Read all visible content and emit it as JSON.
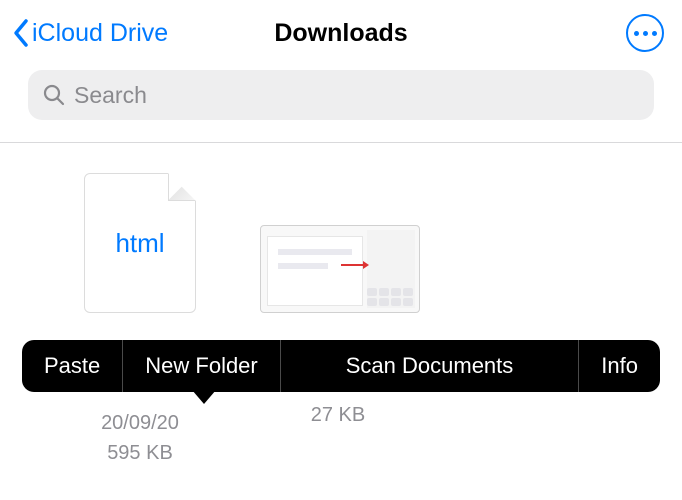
{
  "nav": {
    "back_label": "iCloud Drive",
    "title": "Downloads"
  },
  "search": {
    "placeholder": "Search"
  },
  "files": [
    {
      "badge": "html",
      "date": "20/09/20",
      "size": "595 KB"
    },
    {
      "size": "27 KB"
    }
  ],
  "menu": {
    "paste": "Paste",
    "new_folder": "New Folder",
    "scan": "Scan Documents",
    "info": "Info"
  }
}
